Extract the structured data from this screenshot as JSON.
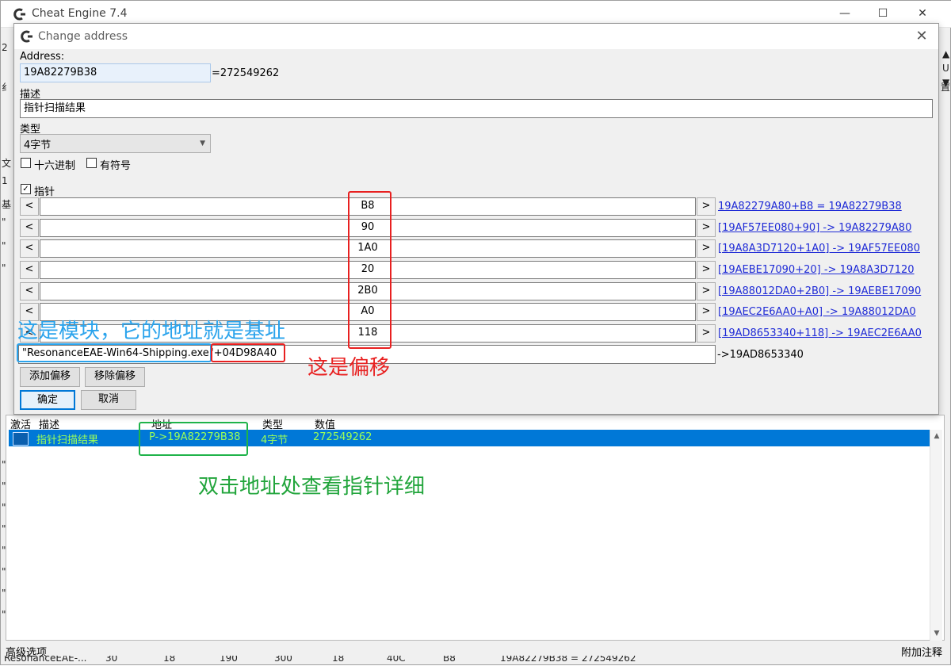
{
  "main_window": {
    "title": "Cheat Engine 7.4",
    "left_edge_glyphs": [
      "2",
      "纟",
      "文",
      "1",
      "基",
      "\"",
      "\"",
      "\"",
      "\"",
      "\"",
      "\"",
      "\"",
      "\"",
      "\"",
      "\"",
      "\""
    ],
    "right_edge_glyphs": [
      "▲",
      "U",
      "▼",
      "置"
    ],
    "list_headers": {
      "active": "激活",
      "description": "描述",
      "address": "地址",
      "type": "类型",
      "value": "数值"
    },
    "selected_row": {
      "description": "指针扫描结果",
      "address": "P->19A82279B38",
      "type": "4字节",
      "value": "272549262"
    },
    "advanced_options": "高级选项",
    "add_comment": "附加注释",
    "bottom_partial_row": [
      "ResonanceEAE-...",
      "30",
      "18",
      "190",
      "300",
      "18",
      "40C",
      "B8",
      "19A82279B38 = 272549262"
    ]
  },
  "dialog": {
    "title": "Change address",
    "address_label": "Address:",
    "address_value": "19A82279B38",
    "address_equals": "=272549262",
    "description_label": "描述",
    "description_value": "指针扫描结果",
    "type_label": "类型",
    "type_value": "4字节",
    "hex_label": "十六进制",
    "signed_label": "有符号",
    "pointer_label": "指针",
    "pointer_checked": "✓",
    "offsets": [
      {
        "value": "B8",
        "link": "19A82279A80+B8 = 19A82279B38"
      },
      {
        "value": "90",
        "link": "[19AF57EE080+90] -> 19A82279A80"
      },
      {
        "value": "1A0",
        "link": "[19A8A3D7120+1A0] -> 19AF57EE080"
      },
      {
        "value": "20",
        "link": "[19AEBE17090+20] -> 19A8A3D7120"
      },
      {
        "value": "2B0",
        "link": "[19A88012DA0+2B0] -> 19AEBE17090"
      },
      {
        "value": "A0",
        "link": "[19AEC2E6AA0+A0] -> 19A88012DA0"
      },
      {
        "value": "118",
        "link": "[19AD8653340+118] -> 19AEC2E6AA0"
      }
    ],
    "dec_btn": "<",
    "inc_btn": ">",
    "base_module": "\"ResonanceEAE-Win64-Shipping.exe\"",
    "base_offset": "+04D98A40",
    "base_result": "->19AD8653340",
    "add_offset": "添加偏移",
    "remove_offset": "移除偏移",
    "ok": "确定",
    "cancel": "取消"
  },
  "annotations": {
    "module_note": "这是模块，它的地址就是基址",
    "offset_note": "这是偏移",
    "doubleclick_note": "双击地址处查看指针详细"
  },
  "colors": {
    "selection": "#0078d7",
    "link": "#1f2bd6",
    "annotation_red": "#e82020",
    "annotation_blue": "#2aa3ec",
    "annotation_green": "#1fb34a"
  }
}
